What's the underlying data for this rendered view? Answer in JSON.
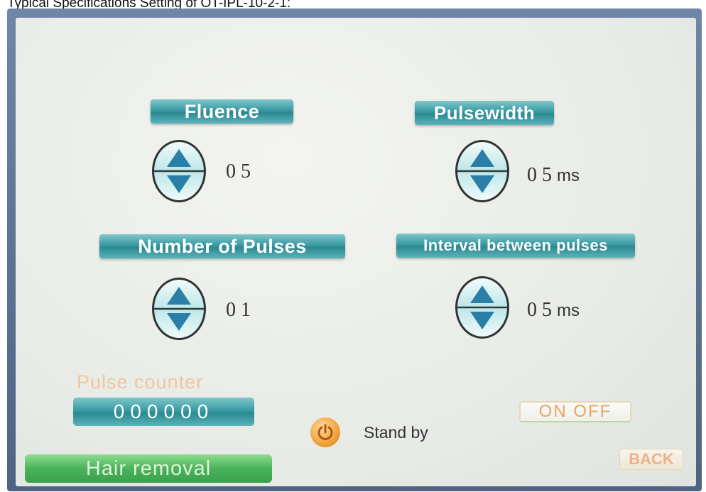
{
  "caption": "Typical Specifications Setting of OT-IPL-10-2-1:",
  "panels": {
    "fluence": {
      "label": "Fluence",
      "value": "0 5",
      "unit": ""
    },
    "pulsewidth": {
      "label": "Pulsewidth",
      "value": "0 5",
      "unit": "ms"
    },
    "num_pulses": {
      "label": "Number of Pulses",
      "value": "0 1",
      "unit": ""
    },
    "interval": {
      "label": "Interval between pulses",
      "value": "0 5",
      "unit": "ms"
    }
  },
  "counter": {
    "label": "Pulse counter",
    "value": "000000"
  },
  "status": {
    "text": "Stand by",
    "icon": "power-icon"
  },
  "buttons": {
    "onoff": "ON  OFF",
    "back": "BACK"
  },
  "mode": {
    "label": "Hair removal"
  },
  "colors": {
    "tag": "#3a9aa2",
    "arrow": "#2a7fa6",
    "mode": "#49b35a",
    "power": "#f2a640"
  }
}
